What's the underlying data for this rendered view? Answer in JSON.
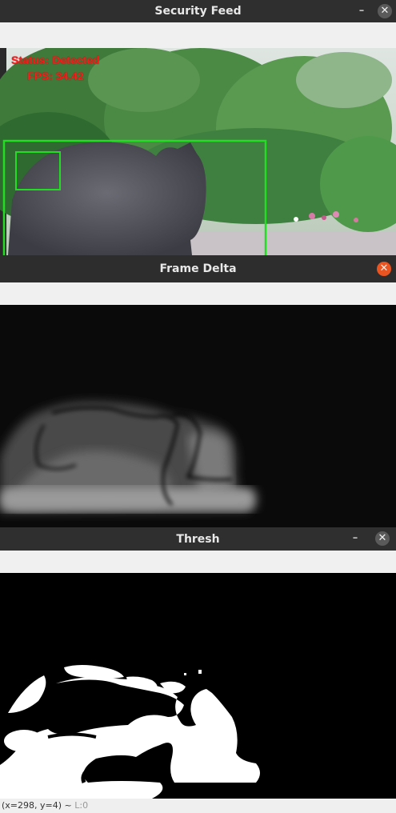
{
  "windows": {
    "security_feed": {
      "title": "Security Feed",
      "min_glyph": "–",
      "close_glyph": "✕",
      "overlay": {
        "status_text": "Status: Detected",
        "fps_text": "FPS: 34.42",
        "text_color": "#ff1a1a",
        "box_color": "#22dd22"
      }
    },
    "frame_delta": {
      "title": "Frame Delta",
      "close_glyph": "✕",
      "close_color": "#e95420"
    },
    "thresh": {
      "title": "Thresh",
      "min_glyph": "–",
      "close_glyph": "✕"
    }
  },
  "statusbar": {
    "coords": "(x=298, y=4) ~",
    "level": "L:0"
  }
}
